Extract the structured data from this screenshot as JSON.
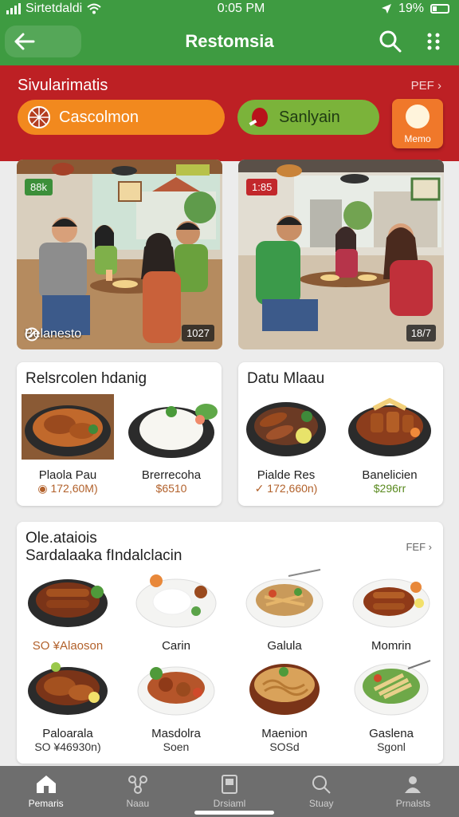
{
  "status": {
    "carrier": "Sirtetdaldi",
    "time": "0:05 PM",
    "battery": "19%"
  },
  "appbar": {
    "title": "Restomsia"
  },
  "promo": {
    "title": "Sivularimatis",
    "link": "PEF",
    "chip_primary": "Cascolmon",
    "chip_secondary": "Sanlyain",
    "menu_tile": "Memo"
  },
  "scenes": [
    {
      "tag": "88k",
      "caption": "Belanesto",
      "badge": "1027"
    },
    {
      "tag": "1:85",
      "caption": "",
      "badge": "18/7"
    }
  ],
  "card_a": {
    "title": "Relsrcolen hdanig",
    "items": [
      {
        "name": "Plaola Pau",
        "price": "172,60M)"
      },
      {
        "name": "Brerrecoha",
        "price": "$6510"
      }
    ]
  },
  "card_b": {
    "title": "Datu Mlaau",
    "items": [
      {
        "name": "Pialde Res",
        "price": "172,660n)"
      },
      {
        "name": "Banelicien",
        "price": "$296rr"
      }
    ]
  },
  "card_c": {
    "title": "Ole.ataiois",
    "subtitle": "Sardalaaka fIndalclacin",
    "link": "FEF",
    "items": [
      {
        "name": "SO ¥Alaoson",
        "sub": "",
        "price": ""
      },
      {
        "name": "Carin",
        "sub": "",
        "price": ""
      },
      {
        "name": "Galula",
        "sub": "",
        "price": ""
      },
      {
        "name": "Momrin",
        "sub": "",
        "price": ""
      },
      {
        "name": "Paloarala",
        "sub": "SO ¥46930n)",
        "price": ""
      },
      {
        "name": "Masdolra",
        "sub": "Soen",
        "price": ""
      },
      {
        "name": "Maenion",
        "sub": "SOSd",
        "price": ""
      },
      {
        "name": "Gaslena",
        "sub": "Sgonl",
        "price": ""
      }
    ]
  },
  "nav": [
    {
      "label": "Pemaris",
      "icon": "home-icon",
      "active": true
    },
    {
      "label": "Naau",
      "icon": "network-icon",
      "active": false
    },
    {
      "label": "Drsiaml",
      "icon": "tablet-icon",
      "active": false
    },
    {
      "label": "Stuay",
      "icon": "search-icon",
      "active": false
    },
    {
      "label": "Prnalsts",
      "icon": "person-icon",
      "active": false
    }
  ],
  "colors": {
    "appbar": "#3e9b41",
    "band": "#bd2024",
    "chip_orange": "#f2891e",
    "chip_green": "#7bb33a",
    "nav": "#6e6e6e"
  }
}
